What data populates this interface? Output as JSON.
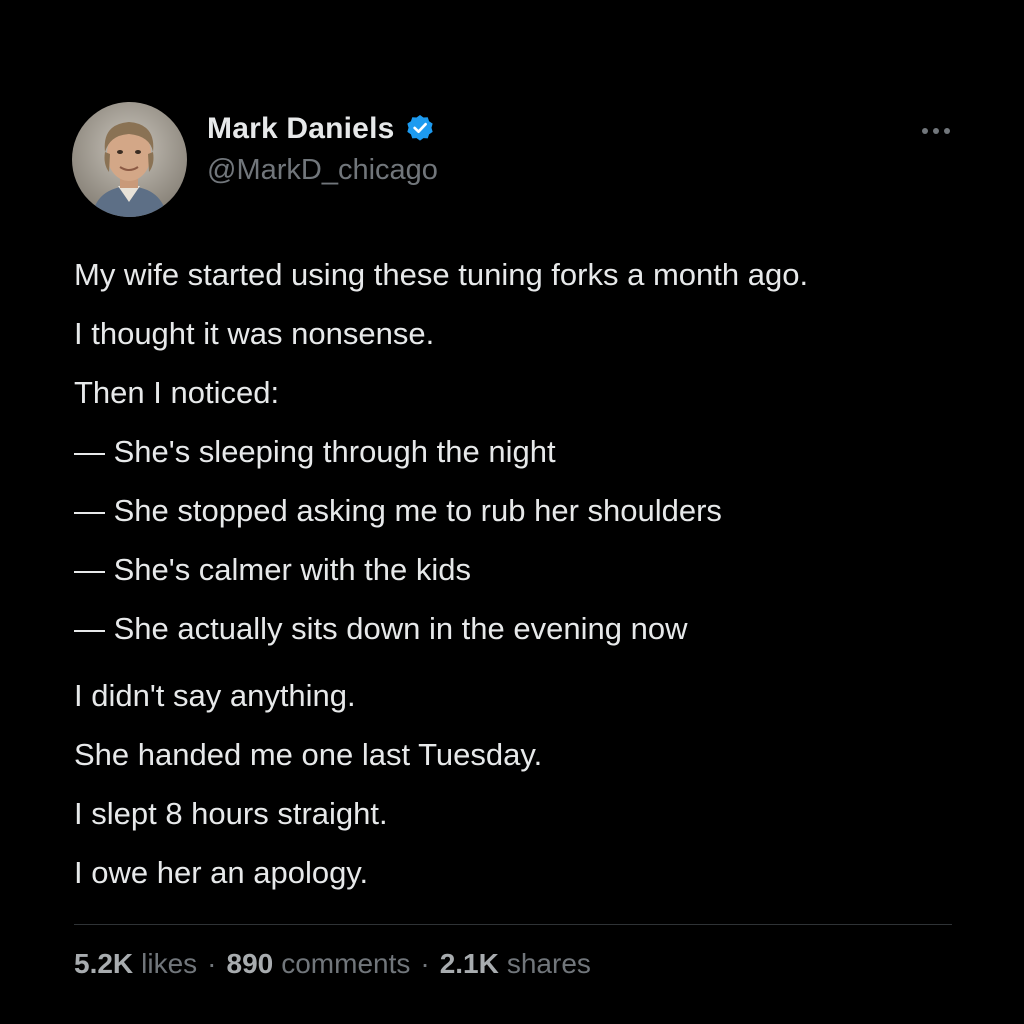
{
  "author": {
    "display_name": "Mark Daniels",
    "handle": "@MarkD_chicago",
    "verified_icon": "verified-badge-icon",
    "avatar_icon": "profile-photo"
  },
  "menu": {
    "icon": "more-options-icon"
  },
  "post": {
    "lines": [
      "My wife started using these tuning forks a month ago.",
      "I thought it was nonsense.",
      "Then I noticed:",
      "— She's sleeping through the night",
      "— She stopped asking me to rub her shoulders",
      "— She's calmer with the kids",
      "— She actually sits down in the evening now",
      "I didn't say anything.",
      "She handed me one last Tuesday.",
      "I slept 8 hours straight.",
      "I owe her an apology."
    ]
  },
  "stats": {
    "likes_count": "5.2K",
    "likes_label": "likes",
    "comments_count": "890",
    "comments_label": "comments",
    "shares_count": "2.1K",
    "shares_label": "shares",
    "separator": "·"
  },
  "colors": {
    "background": "#000000",
    "text": "#e7e9ea",
    "muted": "#71767b",
    "verified": "#1d9bf0",
    "divider": "#2f3336"
  }
}
